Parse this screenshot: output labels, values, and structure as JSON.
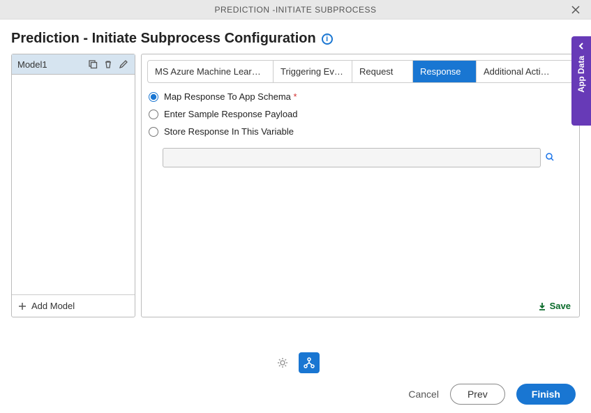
{
  "titlebar": {
    "title": "PREDICTION -INITIATE SUBPROCESS"
  },
  "page": {
    "title": "Prediction - Initiate Subprocess Configuration"
  },
  "sidebar": {
    "items": [
      {
        "label": "Model1"
      }
    ],
    "add_label": "Add Model"
  },
  "tabs": [
    {
      "label": "MS Azure Machine Lear…"
    },
    {
      "label": "Triggering Ev…"
    },
    {
      "label": "Request"
    },
    {
      "label": "Response"
    },
    {
      "label": "Additional Acti…"
    }
  ],
  "radios": {
    "map": "Map Response To App Schema",
    "sample": "Enter Sample Response Payload",
    "store": "Store Response In This Variable"
  },
  "variable_input": {
    "value": ""
  },
  "save_label": "Save",
  "app_data_label": "App Data",
  "footer": {
    "cancel": "Cancel",
    "prev": "Prev",
    "finish": "Finish"
  }
}
